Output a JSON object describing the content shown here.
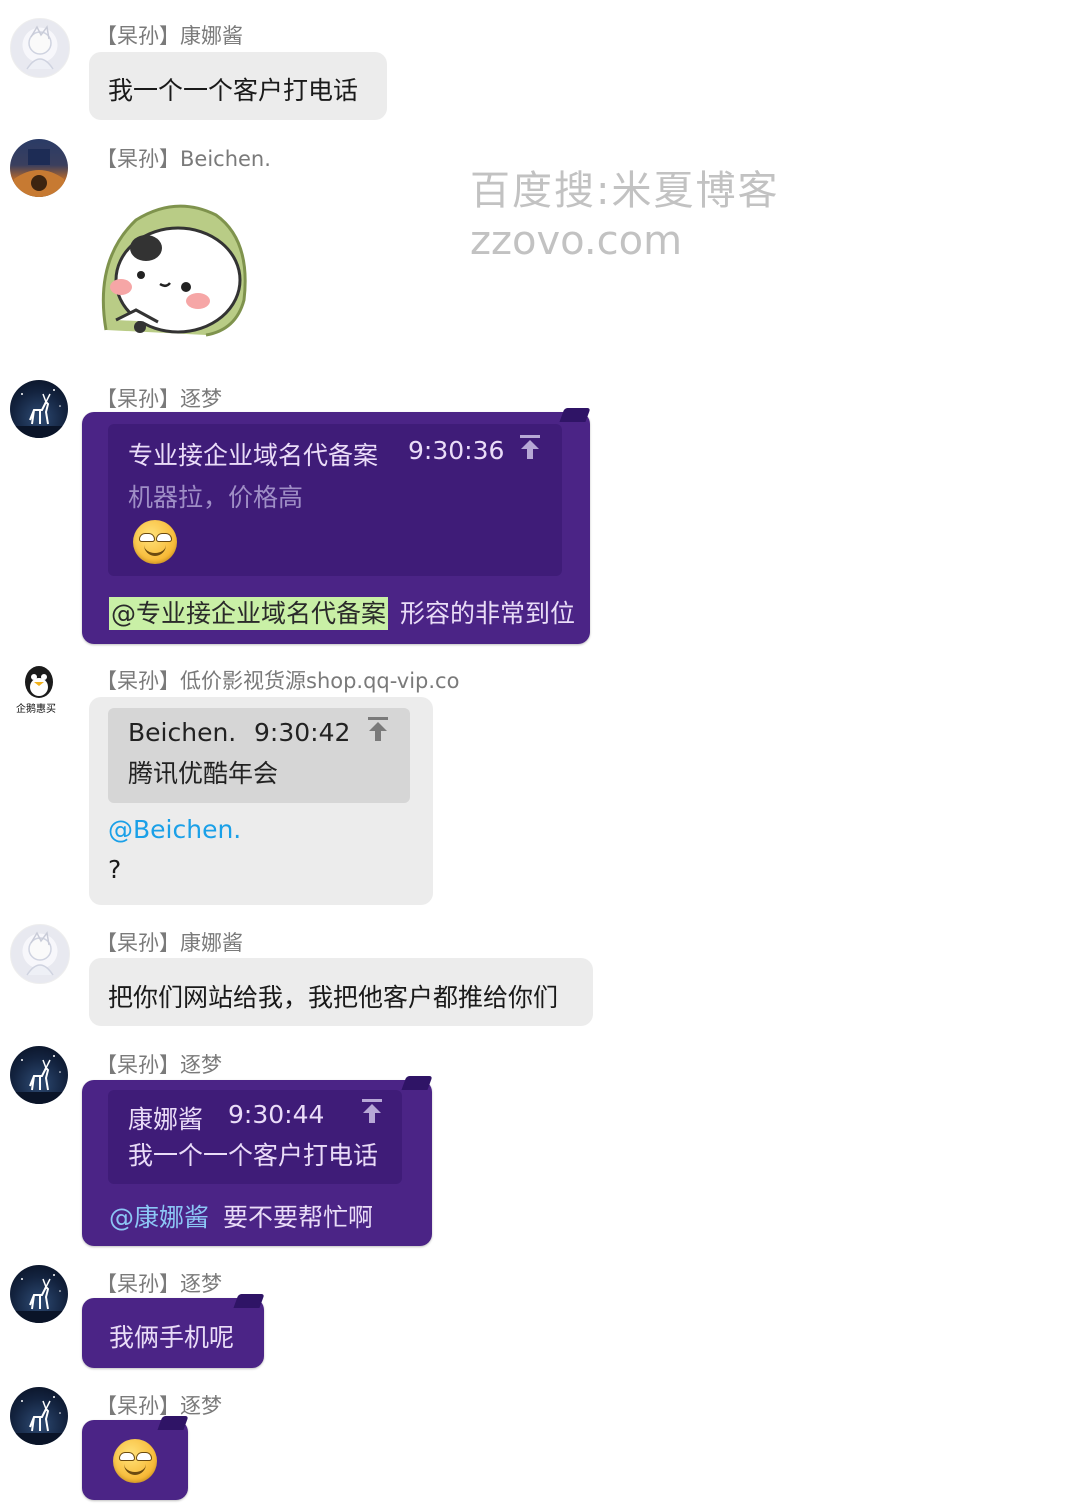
{
  "messages": [
    {
      "sender": "【杲孙】康娜酱",
      "text": "我一个一个客户打电话"
    },
    {
      "sender": "【杲孙】Beichen."
    },
    {
      "sender": "【杲孙】逐梦",
      "quote": {
        "author": "专业接企业域名代备案",
        "time": "9:30:36",
        "text": "机器拉，价格高"
      },
      "mention": "@专业接企业域名代备案",
      "text": "形容的非常到位"
    },
    {
      "sender": "【杲孙】低价影视货源shop.qq-vip.co",
      "avatar_caption": "企鹅惠买",
      "quote": {
        "author": "Beichen.",
        "time": "9:30:42",
        "text": "腾讯优酷年会"
      },
      "mention": "@Beichen.",
      "text": "?"
    },
    {
      "sender": "【杲孙】康娜酱",
      "text": "把你们网站给我，我把他客户都推给你们"
    },
    {
      "sender": "【杲孙】逐梦",
      "quote": {
        "author": "康娜酱",
        "time": "9:30:44",
        "text": "我一个一个客户打电话"
      },
      "mention": "@康娜酱",
      "text": "要不要帮忙啊"
    },
    {
      "sender": "【杲孙】逐梦",
      "text": "我俩手机呢"
    },
    {
      "sender": "【杲孙】逐梦"
    }
  ],
  "watermark": {
    "line1": "百度搜:米夏博客",
    "line2": "zzovo.com"
  },
  "colors": {
    "purple_bubble": "#4b2486",
    "gray_bubble": "#ececec",
    "mention_blue": "#1aa0e8",
    "mention_highlight": "#c9f0a6"
  },
  "icons": [
    "jump-to-quote-icon",
    "smiley-emoji-icon",
    "penguin-icon",
    "sticker-image"
  ]
}
